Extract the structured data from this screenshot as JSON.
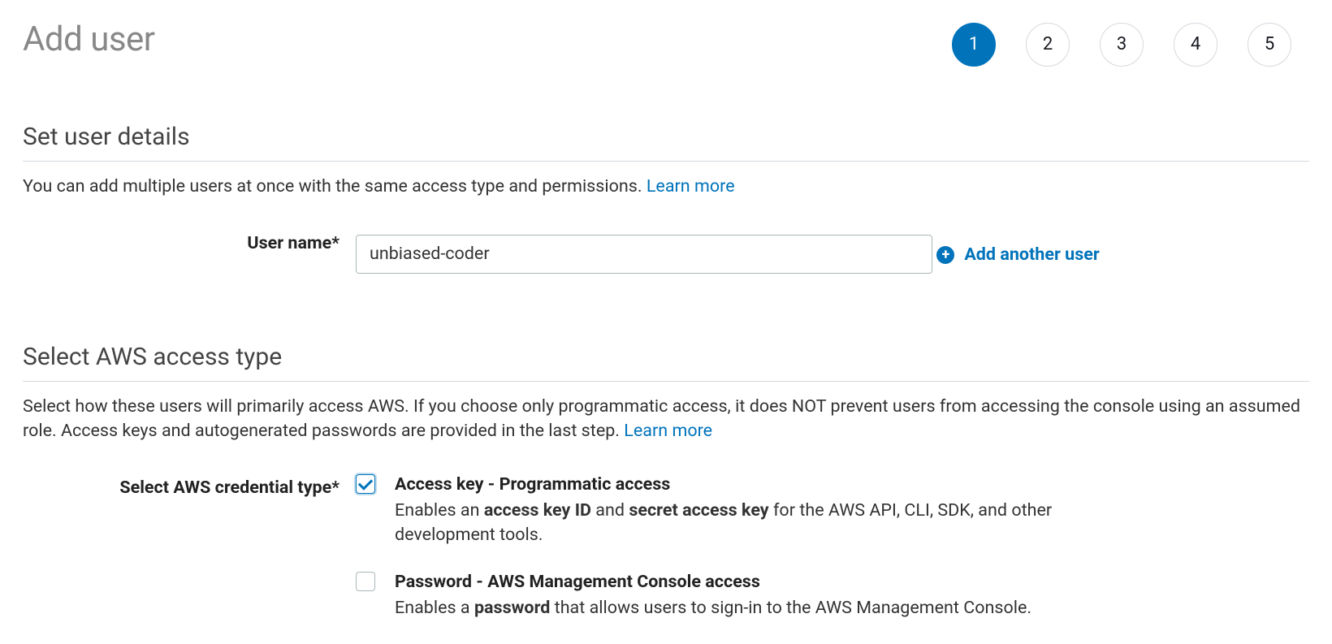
{
  "header": {
    "title": "Add user"
  },
  "stepper": {
    "steps": [
      "1",
      "2",
      "3",
      "4",
      "5"
    ],
    "active_index": 0
  },
  "section_user_details": {
    "title": "Set user details",
    "desc_prefix": "You can add multiple users at once with the same access type and permissions. ",
    "learn_more": "Learn more",
    "username_label": "User name*",
    "username_value": "unbiased-coder",
    "add_another_label": "Add another user"
  },
  "section_access_type": {
    "title": "Select AWS access type",
    "desc_prefix": "Select how these users will primarily access AWS. If you choose only programmatic access, it does NOT prevent users from accessing the console using an assumed role. Access keys and autogenerated passwords are provided in the last step. ",
    "learn_more": "Learn more",
    "credential_label": "Select AWS credential type*",
    "options": [
      {
        "checked": true,
        "title": "Access key - Programmatic access",
        "desc_parts": [
          "Enables an ",
          "access key ID",
          " and ",
          "secret access key",
          " for the AWS API, CLI, SDK, and other development tools."
        ]
      },
      {
        "checked": false,
        "title": "Password - AWS Management Console access",
        "desc_parts": [
          "Enables a ",
          "password",
          " that allows users to sign-in to the AWS Management Console."
        ]
      }
    ]
  }
}
